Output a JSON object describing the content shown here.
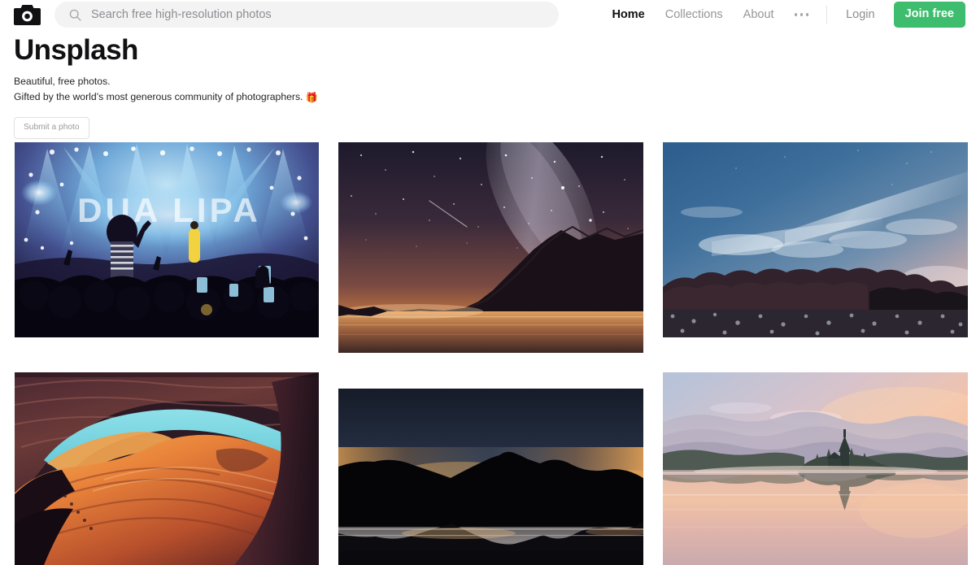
{
  "header": {
    "logo_icon": "camera-icon",
    "search": {
      "icon": "search-icon",
      "placeholder": "Search free high-resolution photos",
      "value": ""
    },
    "nav_links": [
      {
        "label": "Home",
        "active": true
      },
      {
        "label": "Collections",
        "active": false
      },
      {
        "label": "About",
        "active": false
      }
    ],
    "overflow_icon": "ellipsis-icon",
    "login_label": "Login",
    "join_label": "Join free"
  },
  "hero": {
    "title": "Unsplash",
    "subtitle_line1": "Beautiful, free photos.",
    "subtitle_line2": "Gifted by the world’s most generous community of photographers.",
    "gift_emoji": "🎁",
    "submit_label": "Submit a photo"
  },
  "colors": {
    "brand_green": "#3dbd6d",
    "search_bg": "#f3f3f4",
    "text_dark": "#111113",
    "text_muted": "#8e8e93",
    "border": "#e0e0e2"
  },
  "gallery": {
    "photos": [
      {
        "name": "concert-stage-dua-lipa",
        "alt": "Concert crowd in front of a brightly lit stage",
        "row": 1,
        "col": 1
      },
      {
        "name": "milky-way-over-lake",
        "alt": "Milky Way and starry sky over a mountain lake at dusk",
        "row": 1,
        "col": 2
      },
      {
        "name": "blue-twilight-treeline",
        "alt": "Blue twilight sky with wispy clouds above a dark treeline",
        "row": 1,
        "col": 3
      },
      {
        "name": "antelope-slot-canyon",
        "alt": "Orange slot canyon walls framing a turquoise sky",
        "row": 2,
        "col": 1
      },
      {
        "name": "mountain-silhouette-dusk",
        "alt": "Dark mountain silhouette reflected in still water at dusk",
        "row": 2,
        "col": 2
      },
      {
        "name": "lake-bled-sunrise",
        "alt": "Island church on a misty lake at sunrise with mirror reflection",
        "row": 2,
        "col": 3
      }
    ]
  }
}
